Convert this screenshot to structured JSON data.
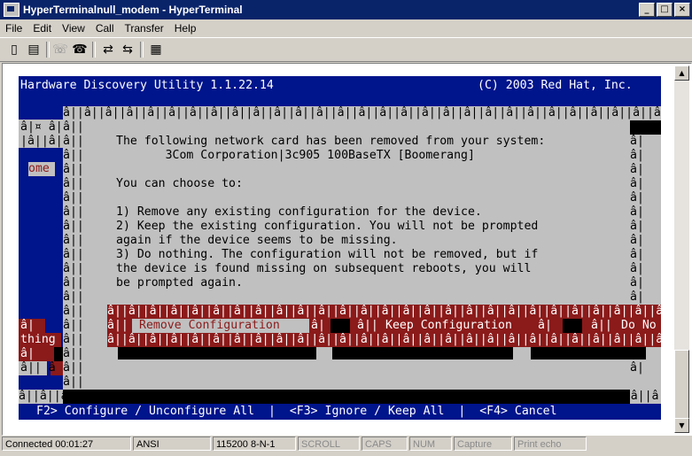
{
  "window": {
    "title": "HyperTerminalnull_modem - HyperTerminal",
    "buttons": [
      "_",
      "□",
      "×"
    ]
  },
  "menu": [
    "File",
    "Edit",
    "View",
    "Call",
    "Transfer",
    "Help"
  ],
  "toolbar": [
    "new-icon",
    "open-icon",
    "connect-icon",
    "disconnect-icon",
    "send-icon",
    "receive-icon",
    "properties-icon"
  ],
  "terminal": {
    "header_left": "Hardware Discovery Utility 1.1.22.14",
    "header_right": "(C) 2003 Red Hat, Inc.",
    "border_row": "â||â||â||â||â||â||â||â||â||â||â||â||â||â||â||â||â||â||â||â||â||â||â||â||â||â||â||â||â||â||â||â||â||â||â||â||â||â||â||â||â||â||â||â||â||",
    "left_frag": [
      "â|¤ â|",
      "|â||â||",
      "ome",
      "â|",
      "thing",
      "â|",
      "â|| â"
    ],
    "edge_left": "â||",
    "edge_right": "â|",
    "body_lines": [
      "The following network card has been removed from your system:",
      "       3Com Corporation|3c905 100BaseTX [Boomerang]",
      "",
      "You can choose to:",
      "",
      "1) Remove any existing configuration for the device.",
      "2) Keep the existing configuration. You will not be prompted",
      "again if the device seems to be missing.",
      "3) Do nothing. The configuration will not be removed, but if",
      "the device is found missing on subsequent reboots, you will",
      "be prompted again."
    ],
    "button_strip": "â||â||â||â||â||â||â||â||â||â||â||â||â||â||â||â||â||â||â||â||â||â||â||â||â||â||â||â||â||â||â||â||â||â||â||â||â||â||",
    "btn_remove": "Remove Configuration",
    "btn_keep": "Keep Configuration",
    "btn_do": "Do No",
    "footer": "F2> Configure / Unconfigure All  |  <F3> Ignore / Keep All  |  <F4> Cancel"
  },
  "status": [
    "Connected 00:01:27",
    "ANSI",
    "115200 8-N-1",
    "SCROLL",
    "CAPS",
    "NUM",
    "Capture",
    "Print echo"
  ]
}
